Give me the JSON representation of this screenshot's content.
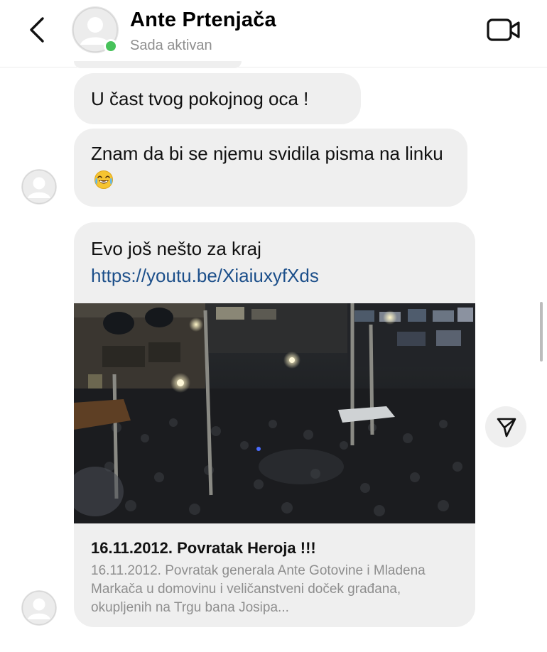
{
  "header": {
    "contact_name": "Ante Prtenjača",
    "status": "Sada aktivan",
    "back_icon": "chevron-left-icon",
    "video_icon": "video-camera-icon",
    "online_color": "#47c25a"
  },
  "messages": [
    {
      "text": "U čast tvog pokojnog oca !"
    },
    {
      "text": "Znam da bi se njemu svidila pisma na linku",
      "emoji": "😂"
    }
  ],
  "link_message": {
    "text": "Evo još nešto za kraj ",
    "url": "https://youtu.be/XiaiuxyfXds",
    "preview": {
      "title": "16.11.2012. Povratak Heroja !!!",
      "description": "16.11.2012. Povratak generala Ante Gotovine i Mladena Markača u domovinu i veličanstveni doček građana, okupljenih na Trgu bana Josipa..."
    }
  },
  "actions": {
    "share_icon": "share-arrow-icon"
  },
  "colors": {
    "bubble": "#efefef",
    "link": "#1c4f8a",
    "secondary_text": "#8e8e8e"
  }
}
